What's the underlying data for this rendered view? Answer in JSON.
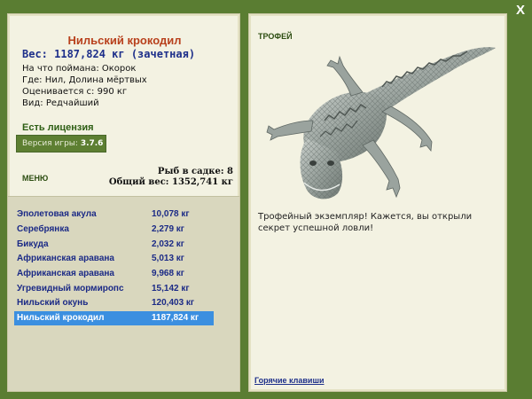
{
  "window": {
    "close_glyph": "X",
    "close_icon": "close-icon"
  },
  "catch": {
    "title": "Нильский крокодил",
    "weight": "Вес: 1187,824 кг (зачетная)",
    "bait": "На что поймана: Окорок",
    "location": "Где: Нил, Долина мёртвых",
    "value": "Оценивается с: 990 кг",
    "rarity": "Вид: Редчайший"
  },
  "license": "Есть лицензия",
  "version": {
    "label": "Версия игры:",
    "number": "3.7.6"
  },
  "menu_label": "МЕНЮ",
  "keepnet": {
    "count": "Рыб в садке: 8",
    "total": "Общий вес: 1352,741 кг"
  },
  "fish_list": [
    {
      "name": "Эполетовая акула",
      "weight": "10,078 кг"
    },
    {
      "name": "Серебрянка",
      "weight": "2,279 кг"
    },
    {
      "name": "Бикуда",
      "weight": "2,032 кг"
    },
    {
      "name": "Африканская аравана",
      "weight": "5,013 кг"
    },
    {
      "name": "Африканская аравана",
      "weight": "9,968 кг"
    },
    {
      "name": "Угревидный мормиропс",
      "weight": "15,142 кг"
    },
    {
      "name": "Нильский окунь",
      "weight": "120,403 кг"
    },
    {
      "name": "Нильский крокодил",
      "weight": "1187,824 кг"
    }
  ],
  "selected_index": 7,
  "trophy": {
    "label": "ТРОФЕЙ",
    "text": "Трофейный экземпляр! Кажется, вы открыли секрет успешной ловли!"
  },
  "hotkeys_link": "Горячие клавиши",
  "colors": {
    "background": "#5a7d32",
    "panel": "#f3f2e2",
    "selected_row": "#3b8fe0",
    "title_red": "#b8401c",
    "link_blue": "#1d2f8a"
  }
}
